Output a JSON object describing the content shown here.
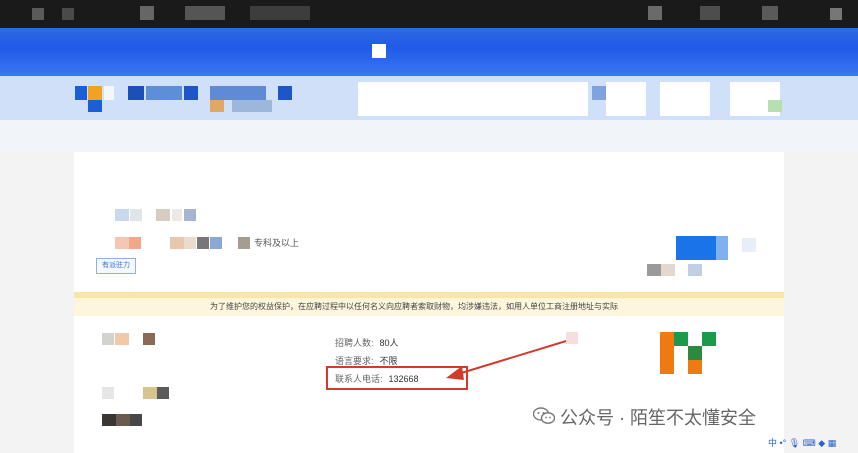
{
  "job": {
    "education": "专科及以上",
    "tag_label": "有派驻力",
    "notice_text": "为了维护您的权益保护，在应聘过程中以任何名义向应聘者索取财物，均涉嫌违法，如用人单位工商注册地址与实际",
    "fields": [
      {
        "label": "招聘人数:",
        "value": "80人"
      },
      {
        "label": "语言要求:",
        "value": "不限"
      },
      {
        "label": "联系人电话:",
        "value": "132668"
      }
    ]
  },
  "watermark": {
    "text": "公众号 · 陌笙不太懂安全"
  },
  "taskbar": {
    "ime_label": "中"
  },
  "colors": {
    "header_blue": "#1f5ae8",
    "annotation_red": "#d23a2c",
    "notice_bg": "#fdf6dc"
  }
}
